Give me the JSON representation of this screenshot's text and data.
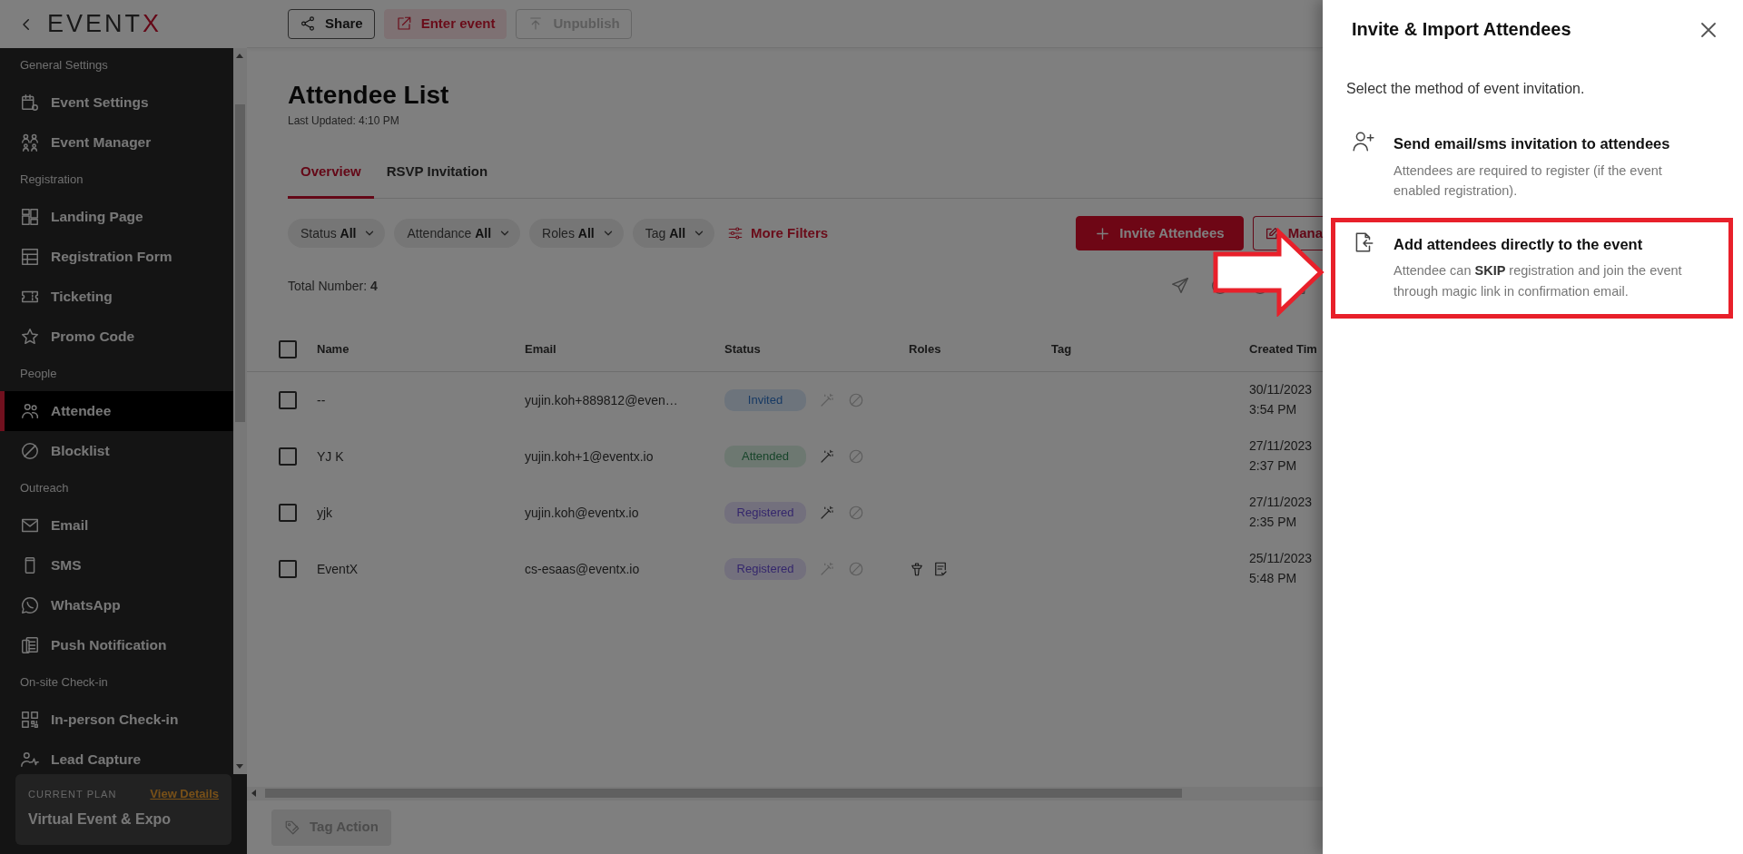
{
  "sidebar": {
    "logo": {
      "main": "EVENT",
      "accent": "X"
    },
    "sections": [
      {
        "label": "General Settings",
        "items": [
          {
            "label": "Event Settings",
            "selected": false
          },
          {
            "label": "Event Manager",
            "selected": false
          }
        ]
      },
      {
        "label": "Registration",
        "items": [
          {
            "label": "Landing Page",
            "selected": false
          },
          {
            "label": "Registration Form",
            "selected": false
          },
          {
            "label": "Ticketing",
            "selected": false
          },
          {
            "label": "Promo Code",
            "selected": false
          }
        ]
      },
      {
        "label": "People",
        "items": [
          {
            "label": "Attendee",
            "selected": true
          },
          {
            "label": "Blocklist",
            "selected": false
          }
        ]
      },
      {
        "label": "Outreach",
        "items": [
          {
            "label": "Email",
            "selected": false
          },
          {
            "label": "SMS",
            "selected": false
          },
          {
            "label": "WhatsApp",
            "selected": false
          },
          {
            "label": "Push Notification",
            "selected": false
          }
        ]
      },
      {
        "label": "On-site Check-in",
        "items": [
          {
            "label": "In-person Check-in",
            "selected": false
          },
          {
            "label": "Lead Capture",
            "selected": false
          }
        ]
      }
    ],
    "plan": {
      "label": "CURRENT PLAN",
      "link": "View Details",
      "name": "Virtual Event & Expo"
    }
  },
  "toolbar": {
    "buttons": [
      {
        "label": "Share",
        "kind": "outline",
        "disabled": false
      },
      {
        "label": "Enter event",
        "kind": "accent",
        "disabled": false
      },
      {
        "label": "Unpublish",
        "kind": "outline",
        "disabled": true
      }
    ]
  },
  "page": {
    "title": "Attendee List",
    "last_updated": "Last Updated: 4:10 PM",
    "tabs": [
      {
        "label": "Overview",
        "selected": true
      },
      {
        "label": "RSVP Invitation",
        "selected": false
      }
    ],
    "filters": [
      {
        "label": "Status",
        "value": "All"
      },
      {
        "label": "Attendance",
        "value": "All"
      },
      {
        "label": "Roles",
        "value": "All"
      },
      {
        "label": "Tag",
        "value": "All"
      }
    ],
    "more_filters": "More Filters",
    "actions": [
      {
        "label": "Invite Attendees",
        "kind": "primary"
      },
      {
        "label": "Mana",
        "kind": "outline"
      }
    ],
    "total_label": "Total Number:",
    "total": "4"
  },
  "table": {
    "all_selected": false,
    "columns": [
      "Name",
      "Email",
      "Status",
      "Roles",
      "Tag",
      "Created Tim"
    ],
    "rows": [
      {
        "selected": false,
        "name": "--",
        "email": "yujin.koh+889812@even…",
        "status": {
          "label": "Invited",
          "kind": "invited"
        },
        "magic_link_active": false,
        "created_date": "30/11/2023",
        "created_time": "3:54 PM"
      },
      {
        "selected": false,
        "name": "YJ K",
        "email": "yujin.koh+1@eventx.io",
        "status": {
          "label": "Attended",
          "kind": "attended"
        },
        "magic_link_active": true,
        "created_date": "27/11/2023",
        "created_time": "2:37 PM"
      },
      {
        "selected": false,
        "name": "yjk",
        "email": "yujin.koh@eventx.io",
        "status": {
          "label": "Registered",
          "kind": "registered"
        },
        "magic_link_active": true,
        "created_date": "27/11/2023",
        "created_time": "2:35 PM"
      },
      {
        "selected": false,
        "name": "EventX",
        "email": "cs-esaas@eventx.io",
        "status": {
          "label": "Registered",
          "kind": "registered"
        },
        "magic_link_active": false,
        "roles": [
          {
            "kind": "speaker"
          },
          {
            "kind": "reviewer"
          }
        ],
        "created_date": "25/11/2023",
        "created_time": "5:48 PM"
      }
    ]
  },
  "footer": {
    "tag_action": {
      "label": "Tag Action",
      "disabled": true
    }
  },
  "panel": {
    "title": "Invite & Import Attendees",
    "subtitle": "Select the method of event invitation.",
    "options": [
      {
        "kind": "invite",
        "title": "Send email/sms invitation to attendees",
        "description": "Attendees are required to register (if the event enabled registration).",
        "highlighted": false
      },
      {
        "kind": "import",
        "title": "Add attendees directly to the event",
        "description": "Attendee can **SKIP** registration and join the event through magic link in confirmation email.",
        "highlighted": true
      }
    ]
  }
}
